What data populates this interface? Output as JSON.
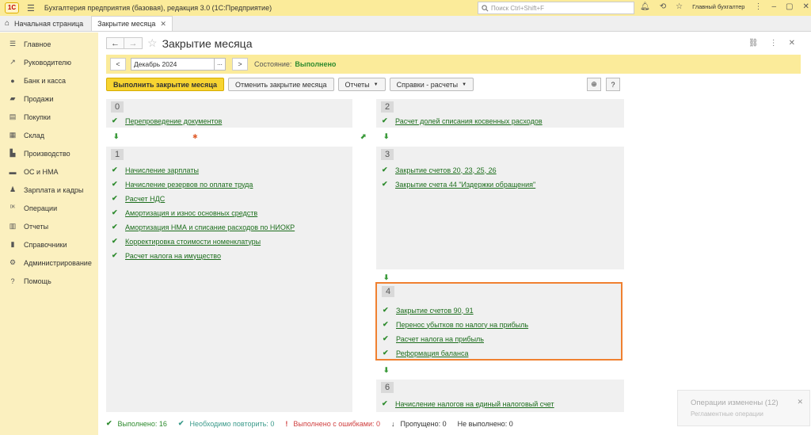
{
  "titlebar": {
    "logo": "1С",
    "app_title": "Бухгалтерия предприятия (базовая), редакция 3.0  (1С:Предприятие)",
    "search_placeholder": "Поиск Ctrl+Shift+F",
    "user": "Главный бухгалтер"
  },
  "tabs": [
    {
      "label": "Начальная страница",
      "active": false
    },
    {
      "label": "Закрытие месяца",
      "active": true
    }
  ],
  "sidebar": {
    "items": [
      {
        "label": "Главное",
        "icon": "list-icon"
      },
      {
        "label": "Руководителю",
        "icon": "trend-icon"
      },
      {
        "label": "Банк и касса",
        "icon": "coins-icon"
      },
      {
        "label": "Продажи",
        "icon": "bag-icon"
      },
      {
        "label": "Покупки",
        "icon": "cart-icon"
      },
      {
        "label": "Склад",
        "icon": "warehouse-icon"
      },
      {
        "label": "Производство",
        "icon": "factory-icon"
      },
      {
        "label": "ОС и НМА",
        "icon": "truck-icon"
      },
      {
        "label": "Зарплата и кадры",
        "icon": "person-icon"
      },
      {
        "label": "Операции",
        "icon": "operations-icon"
      },
      {
        "label": "Отчеты",
        "icon": "chart-icon"
      },
      {
        "label": "Справочники",
        "icon": "book-icon"
      },
      {
        "label": "Администрирование",
        "icon": "gear-icon"
      },
      {
        "label": "Помощь",
        "icon": "help-icon"
      }
    ]
  },
  "form": {
    "title": "Закрытие месяца",
    "period": "Декабрь 2024",
    "state_label": "Состояние:",
    "state_value": "Выполнено",
    "prev_label": "<",
    "next_label": ">",
    "dd_label": "..."
  },
  "commands": {
    "run": "Выполнить закрытие месяца",
    "cancel": "Отменить закрытие месяца",
    "reports": "Отчеты",
    "refs": "Справки - расчеты",
    "help": "?"
  },
  "blocks": {
    "b0": {
      "num": "0",
      "ops": [
        "Перепроведение документов"
      ]
    },
    "b1": {
      "num": "1",
      "ops": [
        "Начисление зарплаты",
        "Начисление резервов по оплате труда",
        "Расчет НДС",
        "Амортизация и износ основных средств",
        "Амортизация НМА и списание расходов по НИОКР",
        "Корректировка стоимости номенклатуры",
        "Расчет налога на имущество"
      ]
    },
    "b2": {
      "num": "2",
      "ops": [
        "Расчет долей списания косвенных расходов"
      ]
    },
    "b3": {
      "num": "3",
      "ops": [
        "Закрытие счетов 20, 23, 25, 26",
        "Закрытие счета 44 \"Издержки обращения\""
      ]
    },
    "b4": {
      "num": "4",
      "ops": [
        "Закрытие счетов 90, 91",
        "Перенос убытков по налогу на прибыль",
        "Расчет налога на прибыль",
        "Реформация баланса"
      ]
    },
    "b6": {
      "num": "6",
      "ops": [
        "Начисление налогов на единый налоговый счет"
      ]
    }
  },
  "footer": {
    "done": "Выполнено: 16",
    "repeat": "Необходимо повторить: 0",
    "errors": "Выполнено с ошибками: 0",
    "skipped": "Пропущено: 0",
    "not_done": "Не выполнено: 0"
  },
  "notification": {
    "title": "Операции изменены (12)",
    "subtitle": "Регламентные операции"
  }
}
